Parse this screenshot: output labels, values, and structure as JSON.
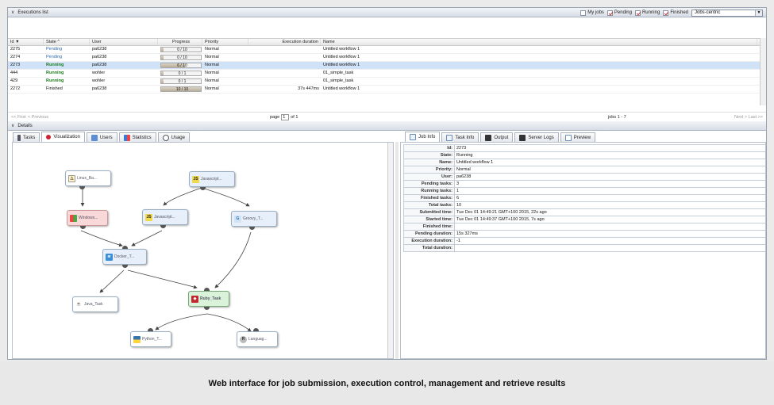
{
  "executions_header": {
    "title": "Executions list"
  },
  "filters": {
    "my_jobs": "My jobs",
    "pending": "Pending",
    "running": "Running",
    "finished": "Finished",
    "view_select": "Jobs-centric"
  },
  "grid": {
    "columns": {
      "id": "Id ▼",
      "state": "State ^",
      "user": "User",
      "progress": "Progress",
      "priority": "Priority",
      "duration": "Execution duration",
      "name": "Name"
    },
    "rows": [
      {
        "id": "2275",
        "state": "Pending",
        "user": "pa6238",
        "progress": "0 / 10",
        "priority": "Normal",
        "duration": "",
        "name": "Untitled workflow 1"
      },
      {
        "id": "2274",
        "state": "Pending",
        "user": "pa6238",
        "progress": "0 / 10",
        "priority": "Normal",
        "duration": "",
        "name": "Untitled workflow 1"
      },
      {
        "id": "2273",
        "state": "Running",
        "user": "pa6238",
        "progress": "6 / 10",
        "priority": "Normal",
        "duration": "",
        "name": "Untitled workflow 1"
      },
      {
        "id": "444",
        "state": "Running",
        "user": "wohler",
        "progress": "0 / 1",
        "priority": "Normal",
        "duration": "",
        "name": "01_simple_task"
      },
      {
        "id": "429",
        "state": "Running",
        "user": "wohler",
        "progress": "0 / 1",
        "priority": "Normal",
        "duration": "",
        "name": "01_simple_task"
      },
      {
        "id": "2272",
        "state": "Finished",
        "user": "pa6238",
        "progress": "10 / 10",
        "priority": "Normal",
        "duration": "37s 447ms",
        "name": "Untitled workflow 1"
      }
    ]
  },
  "pager": {
    "first": "<< First",
    "previous": "< Previous",
    "page_label": "page",
    "page_value": "1",
    "of": "of 1",
    "jobs": "jobs 1 - 7",
    "next": "Next >",
    "last": "Last >>"
  },
  "details_header": {
    "title": "Details"
  },
  "left_tabs": [
    "Tasks",
    "Visualization",
    "Users",
    "Statistics",
    "Usage"
  ],
  "right_tabs": [
    "Job Info",
    "Task Info",
    "Output",
    "Server Logs",
    "Preview"
  ],
  "workflow_nodes": {
    "linux": "Linux_Ba...",
    "javascript1": "Javascript...",
    "windows": "Windows...",
    "javascript2": "Javascript...",
    "groovy": "Groovy_T...",
    "docker": "Docker_T...",
    "java": "Java_Task",
    "ruby": "Ruby_Task",
    "python": "Python_T...",
    "language": "Languag..."
  },
  "job_info": [
    {
      "k": "Id:",
      "v": "2273"
    },
    {
      "k": "State:",
      "v": "Running"
    },
    {
      "k": "Name:",
      "v": "Untitled workflow 1"
    },
    {
      "k": "Priority:",
      "v": "Normal"
    },
    {
      "k": "User:",
      "v": "pa6238"
    },
    {
      "k": "Pending tasks:",
      "v": "3"
    },
    {
      "k": "Running tasks:",
      "v": "1"
    },
    {
      "k": "Finished tasks:",
      "v": "6"
    },
    {
      "k": "Total tasks:",
      "v": "10"
    },
    {
      "k": "Submitted time:",
      "v": "Tue Dec 01 14:49:21 GMT+100 2015, 22s ago"
    },
    {
      "k": "Started time:",
      "v": "Tue Dec 01 14:49:37 GMT+100 2015, 7s ago"
    },
    {
      "k": "Finished time:",
      "v": ""
    },
    {
      "k": "Pending duration:",
      "v": "15s 327ms"
    },
    {
      "k": "Execution duration:",
      "v": "-1"
    },
    {
      "k": "Total duration:",
      "v": ""
    }
  ],
  "caption": "Web interface for job submission, execution control, management and retrieve results",
  "colors": {
    "pending": "#2a6db0",
    "running": "#1c7a1c",
    "selected_row": "#cfe2f7"
  }
}
